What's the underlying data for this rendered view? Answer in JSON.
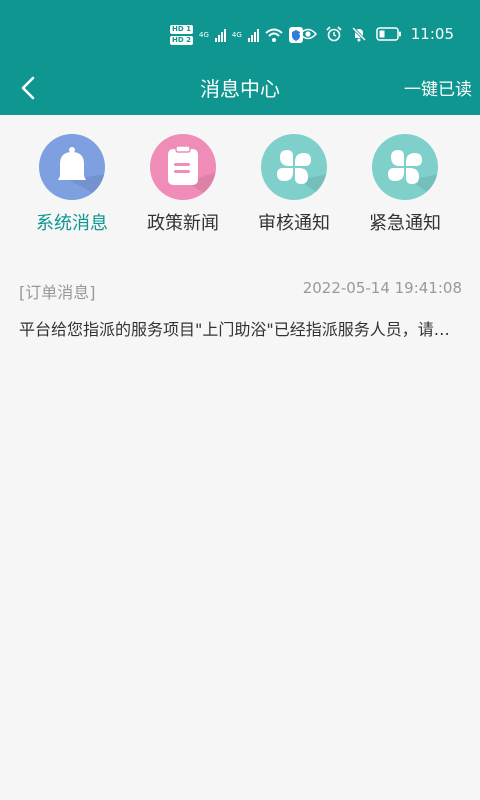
{
  "status_bar": {
    "hd1": "HD 1",
    "hd2": "HD 2",
    "net1": "4G",
    "net2": "4G",
    "time": "11:05"
  },
  "header": {
    "title": "消息中心",
    "action": "一键已读"
  },
  "categories": [
    {
      "label": "系统消息",
      "icon": "bell-icon",
      "color": "#7e9fe0"
    },
    {
      "label": "政策新闻",
      "icon": "clipboard-icon",
      "color": "#f08cb8"
    },
    {
      "label": "审核通知",
      "icon": "clover-icon",
      "color": "#7fd0cb"
    },
    {
      "label": "紧急通知",
      "icon": "clover-icon",
      "color": "#7fd0cb"
    }
  ],
  "messages": [
    {
      "type": "[订单消息]",
      "time": "2022-05-14 19:41:08",
      "body": "平台给您指派的服务项目\"上门助浴\"已经指派服务人员，请注意查收"
    }
  ],
  "colors": {
    "primary": "#0f9690",
    "background": "#f6f6f6"
  }
}
